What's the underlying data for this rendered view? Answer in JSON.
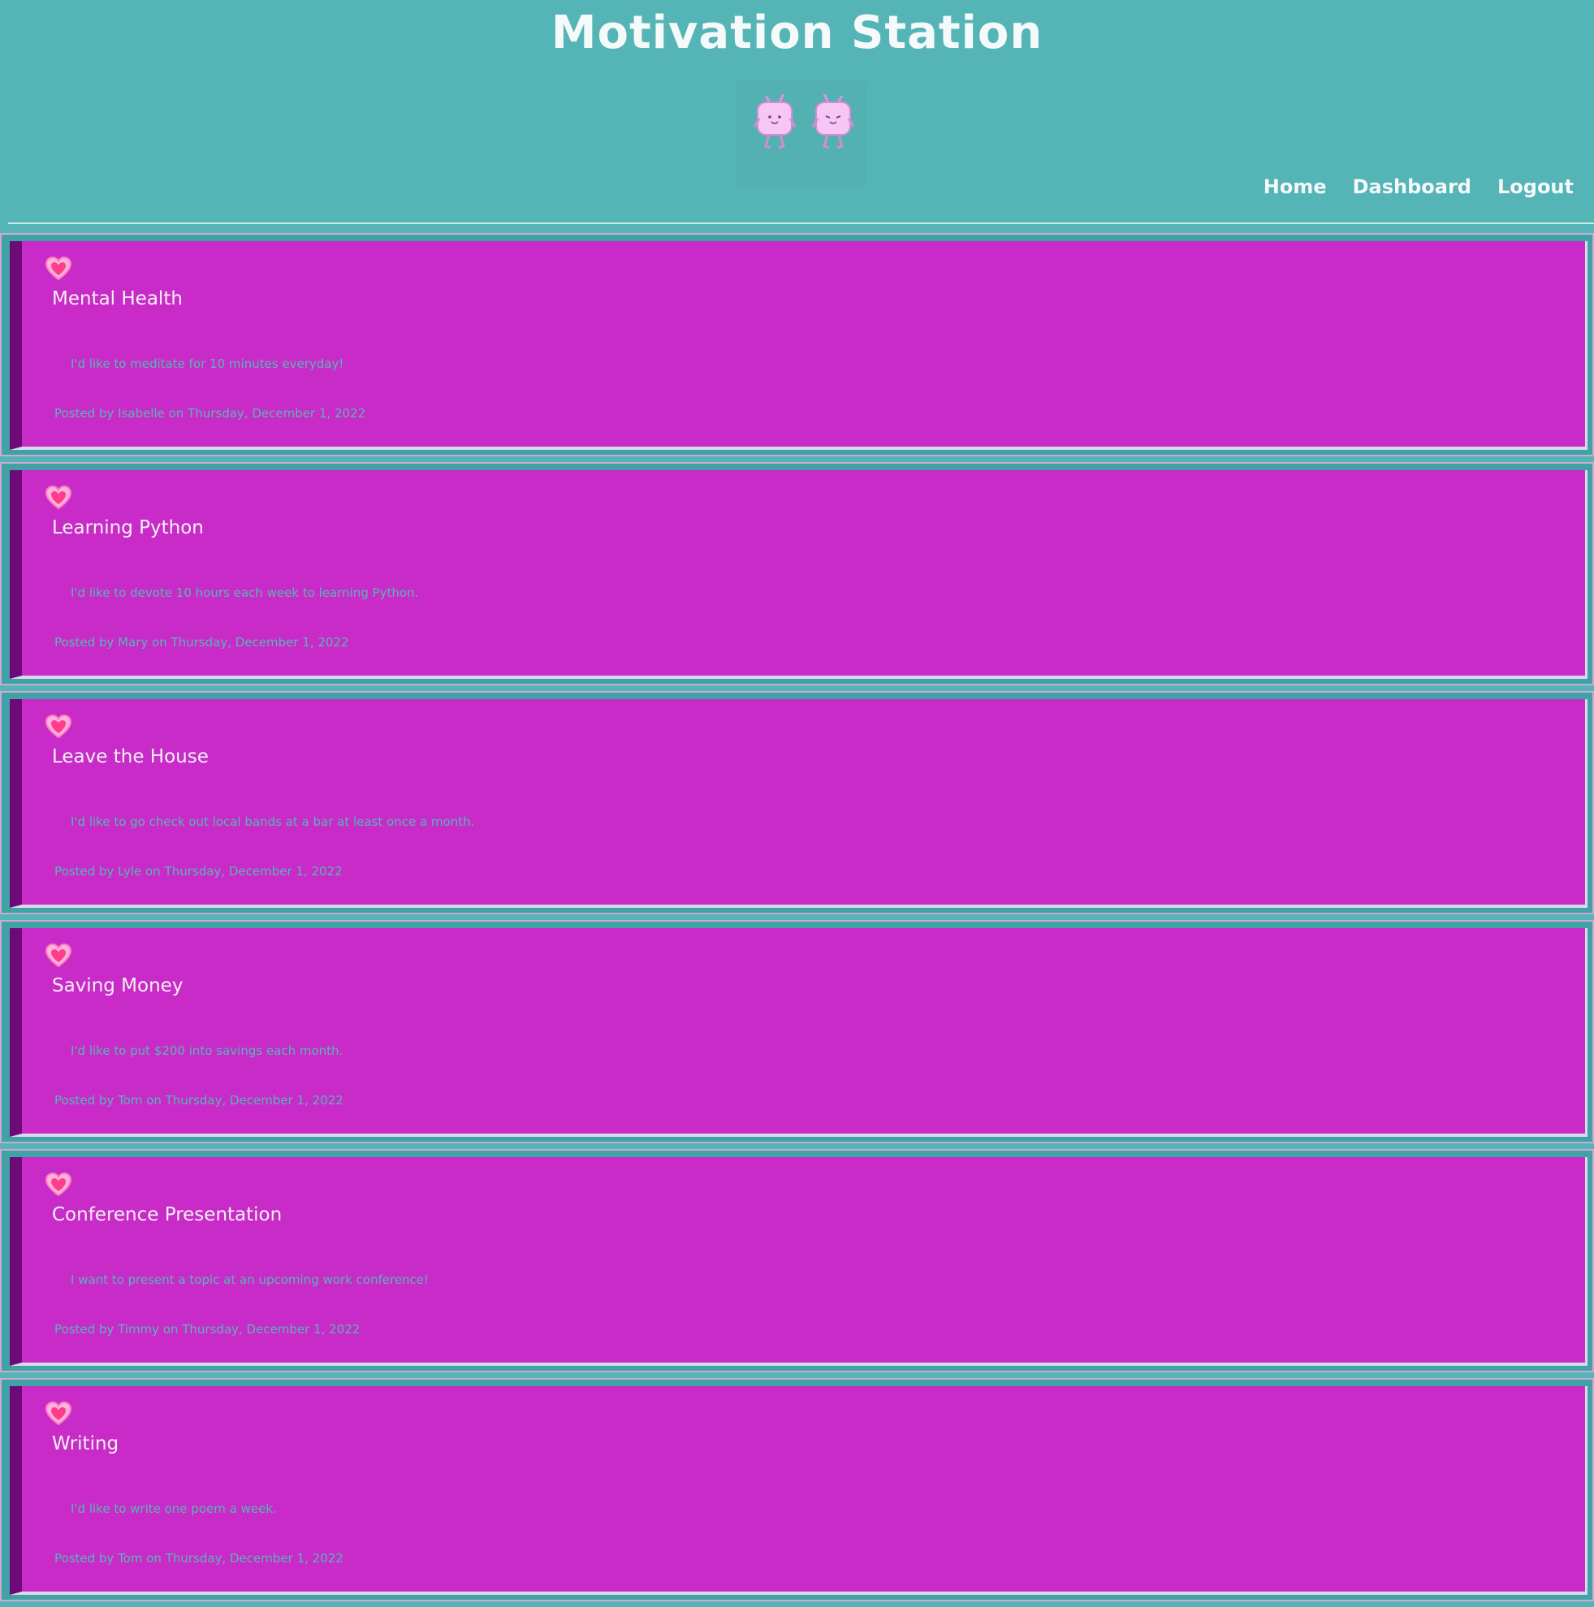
{
  "header": {
    "title": "Motivation Station",
    "logo_icon": "two-pink-cube-creatures-icon"
  },
  "nav": {
    "items": [
      "Home",
      "Dashboard",
      "Logout"
    ]
  },
  "colors": {
    "background": "#55b4b5",
    "card": "#c92bc8",
    "card_accent": "#6e0a78",
    "heart": "#ff4f9a",
    "muted_text": "#56b7b6"
  },
  "posts": [
    {
      "icon": "heart-icon",
      "title": "Mental Health",
      "body": "I'd like to meditate for 10 minutes everyday!",
      "meta": "Posted by Isabelle on Thursday, December 1, 2022"
    },
    {
      "icon": "heart-icon",
      "title": "Learning Python",
      "body": "I'd like to devote 10 hours each week to learning Python.",
      "meta": "Posted by Mary on Thursday, December 1, 2022"
    },
    {
      "icon": "heart-icon",
      "title": "Leave the House",
      "body": "I'd like to go check out local bands at a bar at least once a month.",
      "meta": "Posted by Lyle on Thursday, December 1, 2022"
    },
    {
      "icon": "heart-icon",
      "title": "Saving Money",
      "body": "I'd like to put $200 into savings each month.",
      "meta": "Posted by Tom on Thursday, December 1, 2022"
    },
    {
      "icon": "heart-icon",
      "title": "Conference Presentation",
      "body": "I want to present a topic at an upcoming work conference!",
      "meta": "Posted by Timmy on Thursday, December 1, 2022"
    },
    {
      "icon": "heart-icon",
      "title": "Writing",
      "body": "I'd like to write one poem a week.",
      "meta": "Posted by Tom on Thursday, December 1, 2022"
    }
  ]
}
